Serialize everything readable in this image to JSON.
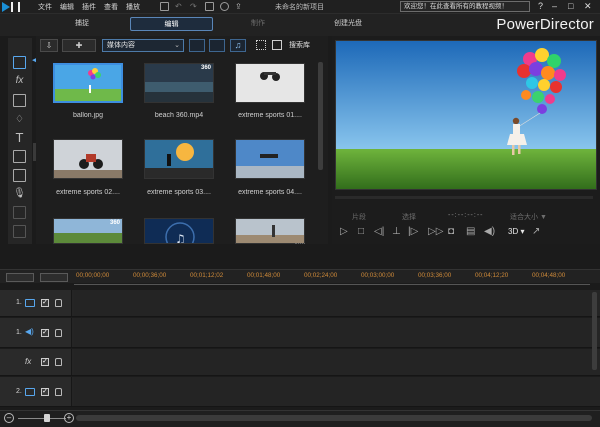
{
  "app": {
    "menu": [
      "文件",
      "编辑",
      "插件",
      "查看",
      "播放"
    ],
    "project_name": "未命名的新项目",
    "welcome_text": "欢迎您！在此查看所有的教程视频！",
    "brand": "PowerDirector",
    "window_controls": [
      "?",
      "–",
      "□",
      "✕"
    ]
  },
  "modes": [
    {
      "label": "捕捉"
    },
    {
      "label": "编辑"
    },
    {
      "label": "制作"
    },
    {
      "label": "创建光盘"
    }
  ],
  "library": {
    "media_filter": "媒体内容",
    "search_label": "搜索库",
    "items": [
      {
        "name": "ballon.jpg"
      },
      {
        "name": "beach 360.mp4",
        "badge": "360"
      },
      {
        "name": "extreme sports 01...."
      },
      {
        "name": "extreme sports 02...."
      },
      {
        "name": "extreme sports 03...."
      },
      {
        "name": "extreme sports 04...."
      },
      {
        "badge": "360"
      },
      {},
      {}
    ]
  },
  "preview": {
    "mode_left": "片段",
    "mode_mid": "选择",
    "timecode": "--:--:--:--",
    "fit_label": "适合大小 ▼",
    "three_d": "3D ▾"
  },
  "timeline": {
    "ruler_ticks": [
      "00;00;00;00",
      "00;00;36;00",
      "00;01;12;02",
      "00;01;48;00",
      "00;02;24;00",
      "00;03;00;00",
      "00;03;36;00",
      "00;04;12;20",
      "00;04;48;00"
    ],
    "tracks": [
      {
        "number": "1.",
        "kind": "video"
      },
      {
        "number": "1.",
        "kind": "audio"
      },
      {
        "number": "",
        "kind": "fx"
      },
      {
        "number": "2.",
        "kind": "video"
      }
    ]
  },
  "colors": {
    "accent": "#3d8ee0",
    "timecode": "#d08b3a",
    "background": "#1b1b1b"
  }
}
